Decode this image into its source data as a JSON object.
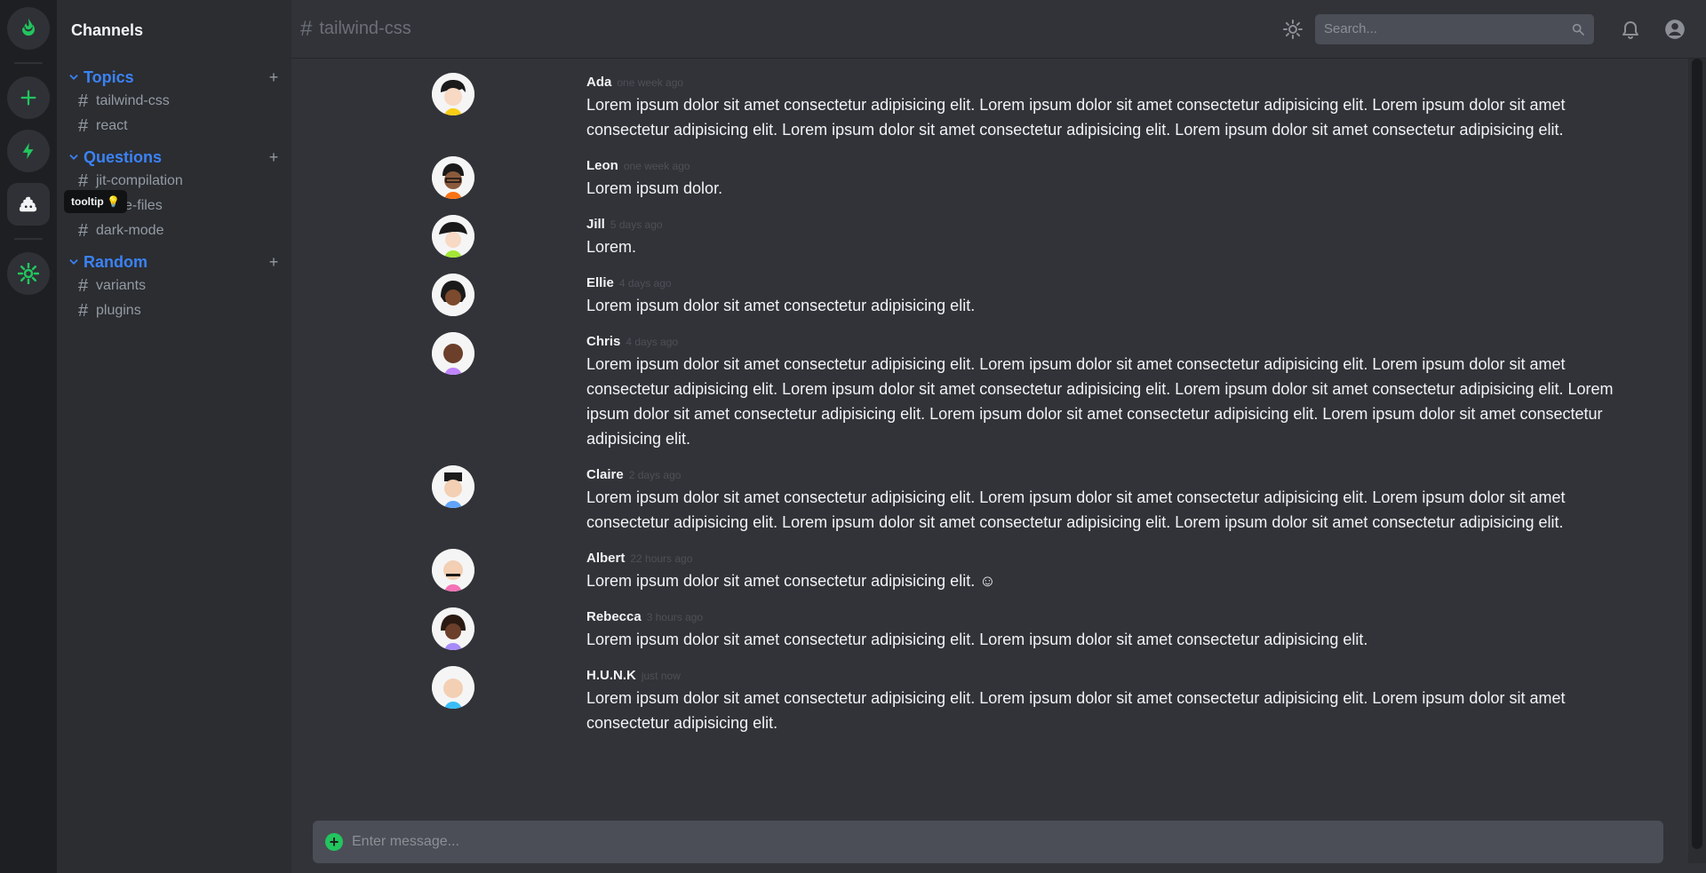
{
  "colors": {
    "accent": "#22c55e",
    "link": "#3b82f6"
  },
  "rail": {
    "tooltip": "tooltip 💡",
    "icons": [
      "fire-icon",
      "plus-icon",
      "bolt-icon",
      "poop-icon",
      "gear-icon"
    ]
  },
  "sidebar": {
    "title": "Channels",
    "groups": [
      {
        "label": "Topics",
        "channels": [
          "tailwind-css",
          "react"
        ]
      },
      {
        "label": "Questions",
        "channels": [
          "jit-compilation",
          "purge-files",
          "dark-mode"
        ]
      },
      {
        "label": "Random",
        "channels": [
          "variants",
          "plugins"
        ]
      }
    ]
  },
  "header": {
    "hash": "#",
    "title": "tailwind-css",
    "search_placeholder": "Search..."
  },
  "messages": [
    {
      "author": "Ada",
      "time": "one week ago",
      "text": "Lorem ipsum dolor sit amet consectetur adipisicing elit. Lorem ipsum dolor sit amet consectetur adipisicing elit. Lorem ipsum dolor sit amet consectetur adipisicing elit. Lorem ipsum dolor sit amet consectetur adipisicing elit. Lorem ipsum dolor sit amet consectetur adipisicing elit."
    },
    {
      "author": "Leon",
      "time": "one week ago",
      "text": "Lorem ipsum dolor."
    },
    {
      "author": "Jill",
      "time": "5 days ago",
      "text": "Lorem."
    },
    {
      "author": "Ellie",
      "time": "4 days ago",
      "text": "Lorem ipsum dolor sit amet consectetur adipisicing elit."
    },
    {
      "author": "Chris",
      "time": "4 days ago",
      "text": "Lorem ipsum dolor sit amet consectetur adipisicing elit. Lorem ipsum dolor sit amet consectetur adipisicing elit. Lorem ipsum dolor sit amet consectetur adipisicing elit. Lorem ipsum dolor sit amet consectetur adipisicing elit. Lorem ipsum dolor sit amet consectetur adipisicing elit. Lorem ipsum dolor sit amet consectetur adipisicing elit. Lorem ipsum dolor sit amet consectetur adipisicing elit. Lorem ipsum dolor sit amet consectetur adipisicing elit."
    },
    {
      "author": "Claire",
      "time": "2 days ago",
      "text": "Lorem ipsum dolor sit amet consectetur adipisicing elit. Lorem ipsum dolor sit amet consectetur adipisicing elit. Lorem ipsum dolor sit amet consectetur adipisicing elit. Lorem ipsum dolor sit amet consectetur adipisicing elit. Lorem ipsum dolor sit amet consectetur adipisicing elit."
    },
    {
      "author": "Albert",
      "time": "22 hours ago",
      "text": "Lorem ipsum dolor sit amet consectetur adipisicing elit. ☺"
    },
    {
      "author": "Rebecca",
      "time": "3 hours ago",
      "text": "Lorem ipsum dolor sit amet consectetur adipisicing elit. Lorem ipsum dolor sit amet consectetur adipisicing elit."
    },
    {
      "author": "H.U.N.K",
      "time": "just now",
      "text": "Lorem ipsum dolor sit amet consectetur adipisicing elit. Lorem ipsum dolor sit amet consectetur adipisicing elit. Lorem ipsum dolor sit amet consectetur adipisicing elit."
    }
  ],
  "composer": {
    "placeholder": "Enter message..."
  }
}
